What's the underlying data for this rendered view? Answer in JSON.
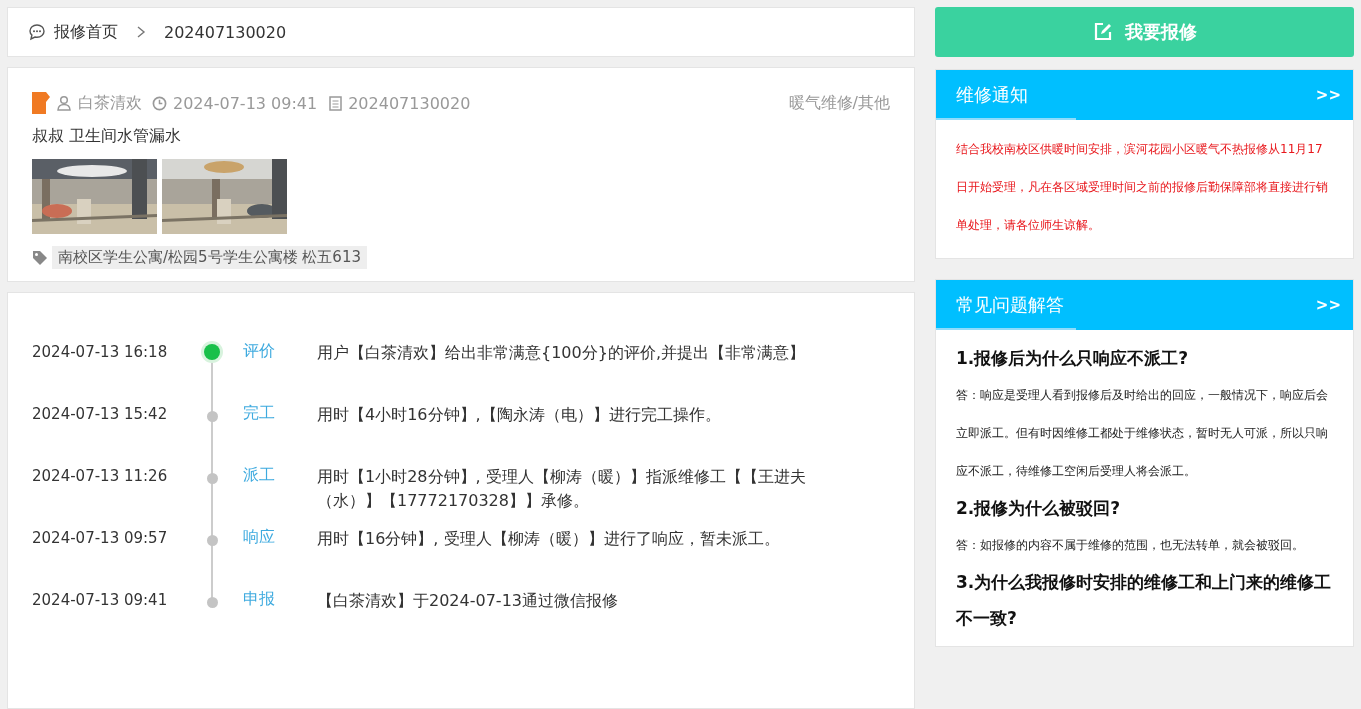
{
  "breadcrumb": {
    "home": "报修首页",
    "current": "202407130020"
  },
  "order": {
    "user": "白茶清欢",
    "time": "2024-07-13 09:41",
    "number": "202407130020",
    "category": "暖气维修/其他",
    "description": "叔叔 卫生间水管漏水",
    "location": "南校区学生公寓/松园5号学生公寓楼 松五613"
  },
  "timeline": [
    {
      "time": "2024-07-13 16:18",
      "status": "评价",
      "text": "用户【白茶清欢】给出非常满意{100分}的评价,并提出【非常满意】",
      "current": true
    },
    {
      "time": "2024-07-13 15:42",
      "status": "完工",
      "text": "用时【4小时16分钟】,【陶永涛（电）】进行完工操作。",
      "current": false
    },
    {
      "time": "2024-07-13 11:26",
      "status": "派工",
      "text": "用时【1小时28分钟】, 受理人【柳涛（暖）】指派维修工【【王进夫（水）】【17772170328】】承修。",
      "current": false
    },
    {
      "time": "2024-07-13 09:57",
      "status": "响应",
      "text": "用时【16分钟】, 受理人【柳涛（暖）】进行了响应，暂未派工。",
      "current": false
    },
    {
      "time": "2024-07-13 09:41",
      "status": "申报",
      "text": "【白茶清欢】于2024-07-13通过微信报修",
      "current": false
    }
  ],
  "report_button": "我要报修",
  "notice": {
    "title": "维修通知",
    "more": ">>",
    "text": "结合我校南校区供暖时间安排，滨河花园小区暖气不热报修从11月17日开始受理，凡在各区域受理时间之前的报修后勤保障部将直接进行销单处理，请各位师生谅解。"
  },
  "faq": {
    "title": "常见问题解答",
    "more": ">>",
    "items": [
      {
        "question": "1.报修后为什么只响应不派工?",
        "answer": "答：响应是受理人看到报修后及时给出的回应，一般情况下，响应后会立即派工。但有时因维修工都处于维修状态，暂时无人可派，所以只响应不派工，待维修工空闲后受理人将会派工。"
      },
      {
        "question": "2.报修为什么被驳回?",
        "answer": "答：如报修的内容不属于维修的范围，也无法转单，就会被驳回。"
      },
      {
        "question": "3.为什么我报修时安排的维修工和上门来的维修工不一致?"
      }
    ]
  }
}
